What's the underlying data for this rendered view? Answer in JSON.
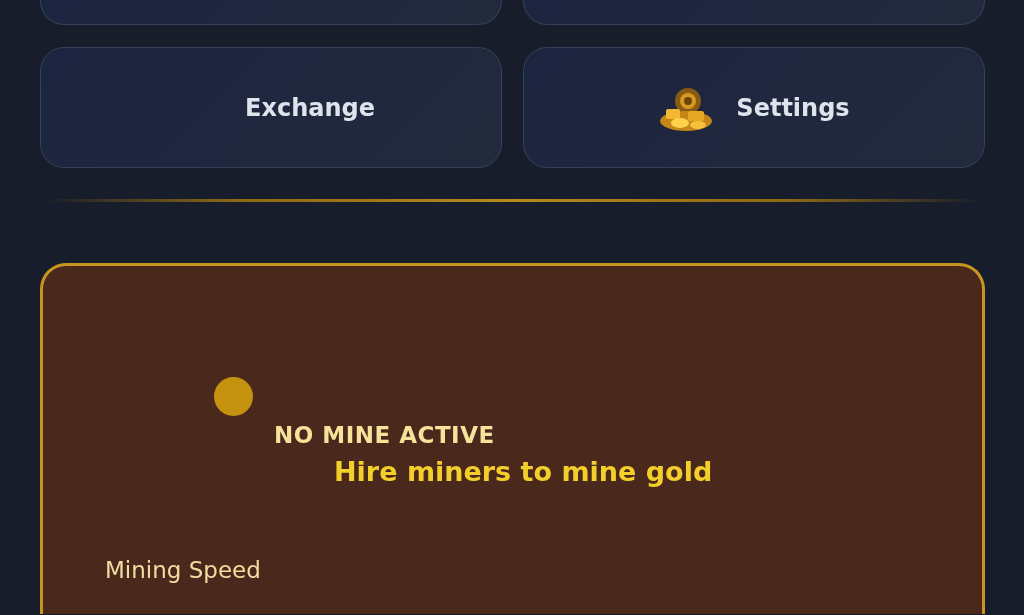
{
  "top_buttons": [
    {
      "kind": "cut"
    },
    {
      "kind": "cut"
    }
  ],
  "nav_buttons": [
    {
      "label": "Exchange",
      "has_icon": false
    },
    {
      "label": "Settings",
      "has_icon": true
    }
  ],
  "mine": {
    "active": false,
    "status": "NO MINE ACTIVE",
    "hint": "Hire miners to mine gold",
    "stat_label": "Mining Speed"
  }
}
